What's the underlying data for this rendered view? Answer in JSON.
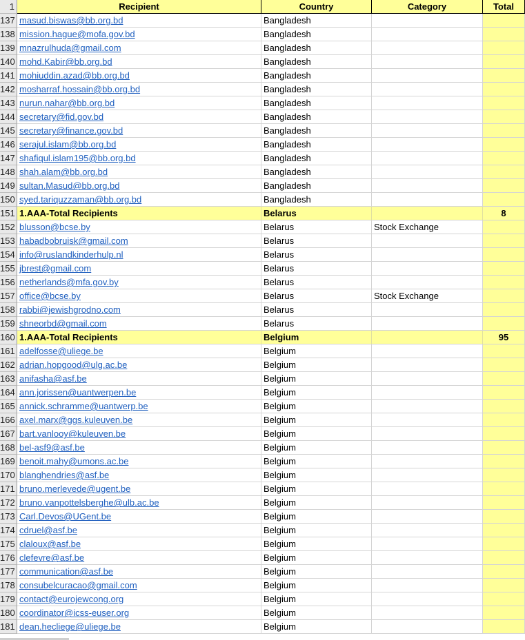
{
  "header": {
    "row_number": "1",
    "recipient": "Recipient",
    "country": "Country",
    "category": "Category",
    "total": "Total"
  },
  "rows": [
    {
      "n": "137",
      "recipient": "masud.biswas@bb.org.bd",
      "country": "Bangladesh",
      "category": "",
      "total": ""
    },
    {
      "n": "138",
      "recipient": "mission.hague@mofa.gov.bd",
      "country": "Bangladesh",
      "category": "",
      "total": ""
    },
    {
      "n": "139",
      "recipient": "mnazrulhuda@gmail.com",
      "country": "Bangladesh",
      "category": "",
      "total": ""
    },
    {
      "n": "140",
      "recipient": "mohd.Kabir@bb.org.bd",
      "country": "Bangladesh",
      "category": "",
      "total": ""
    },
    {
      "n": "141",
      "recipient": "mohiuddin.azad@bb.org.bd",
      "country": "Bangladesh",
      "category": "",
      "total": ""
    },
    {
      "n": "142",
      "recipient": "mosharraf.hossain@bb.org.bd",
      "country": "Bangladesh",
      "category": "",
      "total": ""
    },
    {
      "n": "143",
      "recipient": "nurun.nahar@bb.org.bd",
      "country": "Bangladesh",
      "category": "",
      "total": ""
    },
    {
      "n": "144",
      "recipient": "secretary@fid.gov.bd",
      "country": "Bangladesh",
      "category": "",
      "total": ""
    },
    {
      "n": "145",
      "recipient": "secretary@finance.gov.bd",
      "country": "Bangladesh",
      "category": "",
      "total": ""
    },
    {
      "n": "146",
      "recipient": "serajul.islam@bb.org.bd",
      "country": "Bangladesh",
      "category": "",
      "total": ""
    },
    {
      "n": "147",
      "recipient": "shafiqul.islam195@bb.org.bd",
      "country": "Bangladesh",
      "category": "",
      "total": ""
    },
    {
      "n": "148",
      "recipient": "shah.alam@bb.org.bd",
      "country": "Bangladesh",
      "category": "",
      "total": ""
    },
    {
      "n": "149",
      "recipient": "sultan.Masud@bb.org.bd",
      "country": "Bangladesh",
      "category": "",
      "total": ""
    },
    {
      "n": "150",
      "recipient": "syed.tariquzzaman@bb.org.bd",
      "country": "Bangladesh",
      "category": "",
      "total": ""
    },
    {
      "n": "151",
      "recipient": "1.AAA-Total Recipients",
      "country": "Belarus",
      "category": "",
      "total": "8",
      "subtotal": true
    },
    {
      "n": "152",
      "recipient": "blusson@bcse.by",
      "country": "Belarus",
      "category": "Stock Exchange",
      "total": ""
    },
    {
      "n": "153",
      "recipient": "habadbobruisk@gmail.com",
      "country": "Belarus",
      "category": "",
      "total": ""
    },
    {
      "n": "154",
      "recipient": "info@ruslandkinderhulp.nl",
      "country": "Belarus",
      "category": "",
      "total": ""
    },
    {
      "n": "155",
      "recipient": "jbrest@gmail.com",
      "country": "Belarus",
      "category": "",
      "total": ""
    },
    {
      "n": "156",
      "recipient": "netherlands@mfa.gov.by",
      "country": "Belarus",
      "category": "",
      "total": ""
    },
    {
      "n": "157",
      "recipient": "office@bcse.by",
      "country": "Belarus",
      "category": "Stock Exchange",
      "total": ""
    },
    {
      "n": "158",
      "recipient": "rabbi@jewishgrodno.com",
      "country": "Belarus",
      "category": "",
      "total": ""
    },
    {
      "n": "159",
      "recipient": "shneorbd@gmail.com",
      "country": "Belarus",
      "category": "",
      "total": ""
    },
    {
      "n": "160",
      "recipient": "1.AAA-Total Recipients",
      "country": "Belgium",
      "category": "",
      "total": "95",
      "subtotal": true
    },
    {
      "n": "161",
      "recipient": "adelfosse@uliege.be",
      "country": "Belgium",
      "category": "",
      "total": ""
    },
    {
      "n": "162",
      "recipient": "adrian.hopgood@ulg.ac.be",
      "country": "Belgium",
      "category": "",
      "total": ""
    },
    {
      "n": "163",
      "recipient": "anifasha@asf.be",
      "country": "Belgium",
      "category": "",
      "total": ""
    },
    {
      "n": "164",
      "recipient": "ann.jorissen@uantwerpen.be",
      "country": "Belgium",
      "category": "",
      "total": ""
    },
    {
      "n": "165",
      "recipient": "annick.schramme@uantwerp.be",
      "country": "Belgium",
      "category": "",
      "total": ""
    },
    {
      "n": "166",
      "recipient": "axel.marx@ggs.kuleuven.be",
      "country": "Belgium",
      "category": "",
      "total": ""
    },
    {
      "n": "167",
      "recipient": "bart.vanlooy@kuleuven.be",
      "country": "Belgium",
      "category": "",
      "total": ""
    },
    {
      "n": "168",
      "recipient": "bel-asf9@asf.be",
      "country": "Belgium",
      "category": "",
      "total": ""
    },
    {
      "n": "169",
      "recipient": "benoit.mahy@umons.ac.be",
      "country": "Belgium",
      "category": "",
      "total": ""
    },
    {
      "n": "170",
      "recipient": "blanghendries@asf.be",
      "country": "Belgium",
      "category": "",
      "total": ""
    },
    {
      "n": "171",
      "recipient": "bruno.merlevede@ugent.be",
      "country": "Belgium",
      "category": "",
      "total": ""
    },
    {
      "n": "172",
      "recipient": "bruno.vanpottelsberghe@ulb.ac.be",
      "country": "Belgium",
      "category": "",
      "total": ""
    },
    {
      "n": "173",
      "recipient": "Carl.Devos@UGent.be",
      "country": "Belgium",
      "category": "",
      "total": ""
    },
    {
      "n": "174",
      "recipient": "cdruel@asf.be",
      "country": "Belgium",
      "category": "",
      "total": ""
    },
    {
      "n": "175",
      "recipient": "claloux@asf.be",
      "country": "Belgium",
      "category": "",
      "total": ""
    },
    {
      "n": "176",
      "recipient": "clefevre@asf.be",
      "country": "Belgium",
      "category": "",
      "total": ""
    },
    {
      "n": "177",
      "recipient": "communication@asf.be",
      "country": "Belgium",
      "category": "",
      "total": ""
    },
    {
      "n": "178",
      "recipient": "consubelcuracao@gmail.com",
      "country": "Belgium",
      "category": "",
      "total": ""
    },
    {
      "n": "179",
      "recipient": "contact@eurojewcong.org",
      "country": "Belgium",
      "category": "",
      "total": ""
    },
    {
      "n": "180",
      "recipient": "coordinator@icss-euser.org",
      "country": "Belgium",
      "category": "",
      "total": ""
    },
    {
      "n": "181",
      "recipient": "dean.hecliege@uliege.be",
      "country": "Belgium",
      "category": "",
      "total": ""
    }
  ]
}
